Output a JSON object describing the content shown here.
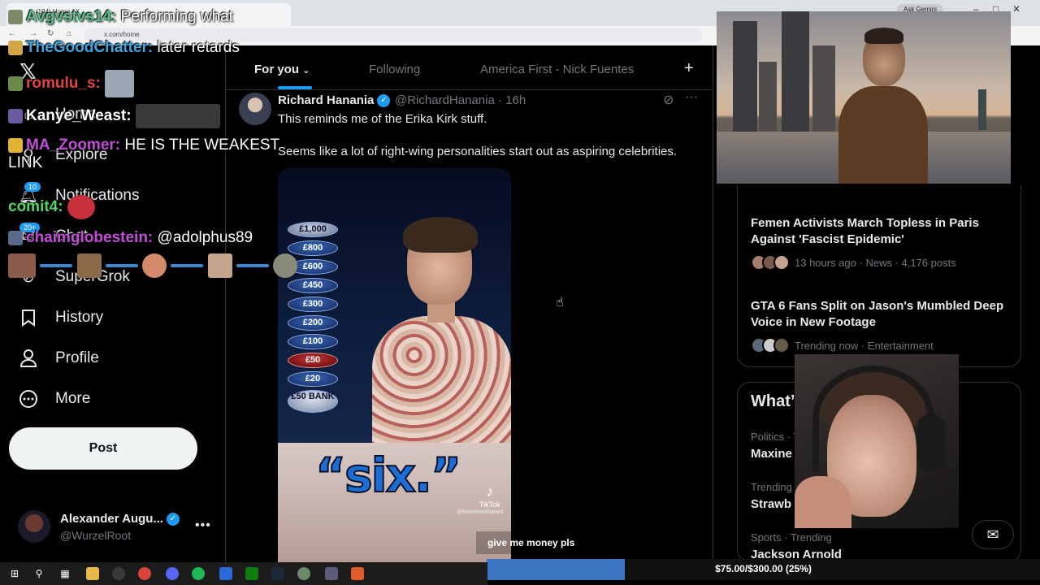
{
  "browser": {
    "tab_title": "(194) Home / X",
    "url": "x.com/home",
    "gemini_label": "Ask Gemini"
  },
  "nav": {
    "items": [
      {
        "label": "Home",
        "icon": "home-icon"
      },
      {
        "label": "Explore",
        "icon": "search-icon"
      },
      {
        "label": "Notifications",
        "icon": "bell-icon",
        "badge": "10"
      },
      {
        "label": "Chat",
        "icon": "mail-icon",
        "badge": "20+"
      },
      {
        "label": "SuperGrok",
        "icon": "grok-icon"
      },
      {
        "label": "History",
        "icon": "bookmark-icon"
      },
      {
        "label": "Profile",
        "icon": "person-icon"
      },
      {
        "label": "More",
        "icon": "more-circle-icon"
      }
    ],
    "post_label": "Post",
    "account": {
      "name": "Alexander Augu...",
      "handle": "@WurzelRoot"
    }
  },
  "feed": {
    "tabs": [
      "For you",
      "Following",
      "America First - Nick Fuentes"
    ],
    "active_tab": "For you",
    "tweet": {
      "name": "Richard Hanania",
      "handle": "@RichardHanania",
      "time": "16h",
      "text_1": "This reminds me of the Erika Kirk stuff.",
      "text_2": "Seems like a lot of right-wing personalities start out as aspiring celebrities.",
      "media": {
        "ladder": [
          "£1,000",
          "£800",
          "£600",
          "£450",
          "£300",
          "£200",
          "£100",
          "£50",
          "£20",
          "£50 BANK"
        ],
        "caption": "“six.”",
        "watermark": "TikTok",
        "watermark_handle": "@evenmorebased"
      }
    }
  },
  "sidebar": {
    "trends": [
      {
        "title": "Femen Activists March Topless in Paris Against 'Fascist Epidemic'",
        "meta": "13 hours ago · News · 4,176 posts"
      },
      {
        "title": "GTA 6 Fans Split on Jason's Mumbled Deep Voice in New Footage",
        "meta": "Trending now · Entertainment"
      }
    ],
    "whats_happening_title": "What’s",
    "items": [
      {
        "meta": "Politics · T",
        "title": "Maxine"
      },
      {
        "meta": "Trending",
        "title": "Strawb"
      },
      {
        "meta": "Sports · Trending",
        "title": "Jackson Arnold"
      }
    ]
  },
  "chat": [
    {
      "user": "Avgvstvs14:",
      "msg": "Performing what",
      "color": "#59c08a"
    },
    {
      "user": "TheGoodChatter:",
      "msg": "later retards",
      "color": "#3fa3e0"
    },
    {
      "user": "romulu_s:",
      "msg": "",
      "color": "#e0453a"
    },
    {
      "user": "Kanye_Weast:",
      "msg": "",
      "color": "#ffffff"
    },
    {
      "user": "MA_Zoomer:",
      "msg": "HE IS THE WEAKEST LINK",
      "color": "#c14fd6"
    },
    {
      "user": "comit4:",
      "msg": "",
      "color": "#4fd667"
    },
    {
      "user": "chaimglobestein:",
      "msg": "@adolphus89",
      "color": "#c14fd6"
    }
  ],
  "donation": {
    "label": "give me money pls",
    "progress_text": "$75.00/$300.00 (25%)",
    "progress": 0.25
  },
  "colors": {
    "accent": "#1d9bf0",
    "bar": "#3a76c2"
  }
}
